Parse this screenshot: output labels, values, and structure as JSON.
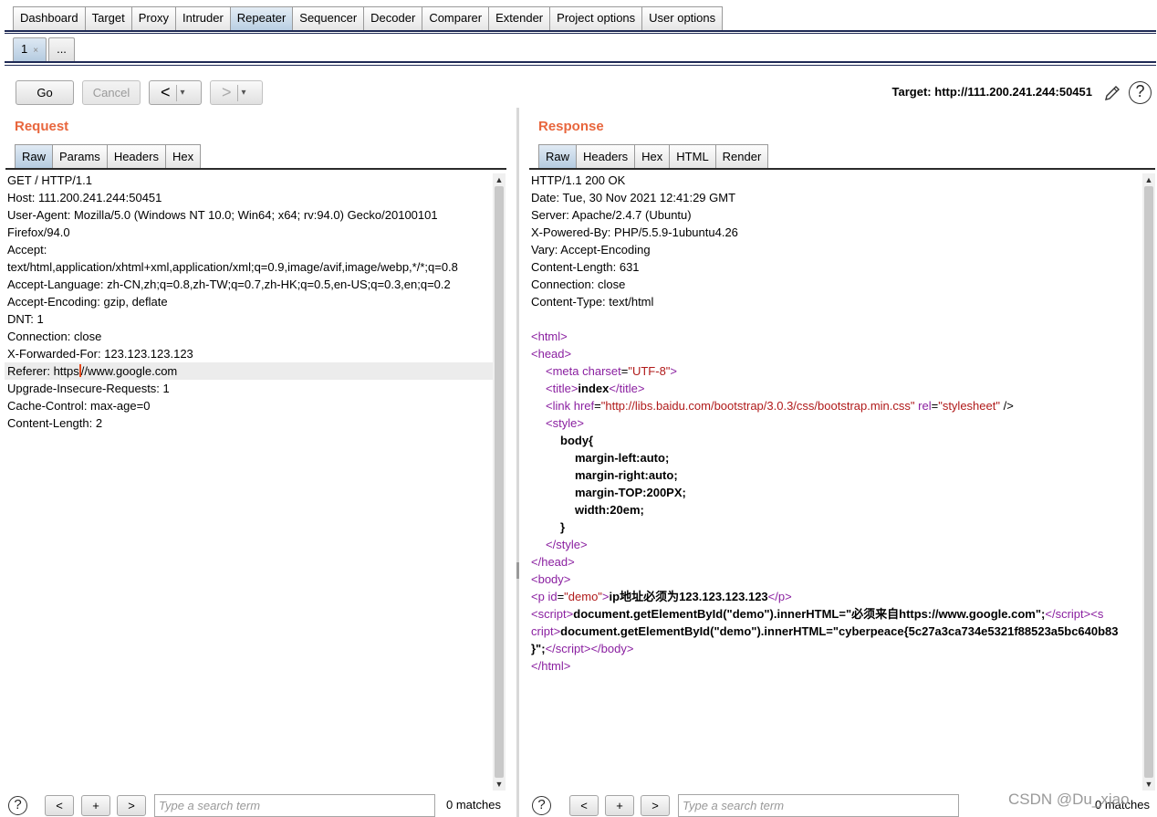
{
  "top_tabs": [
    "Dashboard",
    "Target",
    "Proxy",
    "Intruder",
    "Repeater",
    "Sequencer",
    "Decoder",
    "Comparer",
    "Extender",
    "Project options",
    "User options"
  ],
  "active_top_tab": "Repeater",
  "sub_tabs": {
    "first": "1",
    "more": "..."
  },
  "toolbar": {
    "go": "Go",
    "cancel": "Cancel",
    "back": "<",
    "forward": ">",
    "dropdown": "▾",
    "target": "Target: http://111.200.241.244:50451"
  },
  "request": {
    "title": "Request",
    "tabs": [
      "Raw",
      "Params",
      "Headers",
      "Hex"
    ],
    "lines": [
      "GET / HTTP/1.1",
      "Host: 111.200.241.244:50451",
      "User-Agent: Mozilla/5.0 (Windows NT 10.0; Win64; x64; rv:94.0) Gecko/20100101",
      "Firefox/94.0",
      "Accept:",
      "text/html,application/xhtml+xml,application/xml;q=0.9,image/avif,image/webp,*/*;q=0.8",
      "Accept-Language: zh-CN,zh;q=0.8,zh-TW;q=0.7,zh-HK;q=0.5,en-US;q=0.3,en;q=0.2",
      "Accept-Encoding: gzip, deflate",
      "DNT: 1",
      "Connection: close",
      "X-Forwarded-For: 123.123.123.123",
      "Referer: https",
      "Upgrade-Insecure-Requests: 1",
      "Cache-Control: max-age=0",
      "Content-Length: 2"
    ],
    "referer_rest": "//www.google.com"
  },
  "response": {
    "title": "Response",
    "tabs": [
      "Raw",
      "Headers",
      "Hex",
      "HTML",
      "Render"
    ],
    "headers": [
      "HTTP/1.1 200 OK",
      "Date: Tue, 30 Nov 2021 12:41:29 GMT",
      "Server: Apache/2.4.7 (Ubuntu)",
      "X-Powered-By: PHP/5.5.9-1ubuntu4.26",
      "Vary: Accept-Encoding",
      "Content-Length: 631",
      "Connection: close",
      "Content-Type: text/html"
    ],
    "body": {
      "lt": "<",
      "gt": ">",
      "slash": "/",
      "html": "html",
      "head": "head",
      "meta_tag": "meta",
      "charset_attr": "charset",
      "charset_val": "\"UTF-8\"",
      "title_tag": "title",
      "title_text": "index",
      "link_tag": "link",
      "href_attr": "href",
      "href_val": "\"http://libs.baidu.com/bootstrap/3.0.3/css/bootstrap.min.css\"",
      "rel_attr": "rel",
      "rel_val": "\"stylesheet\"",
      "self_close": " />",
      "style_tag": "style",
      "css_lines": [
        "body{",
        "margin-left:auto;",
        "margin-right:auto;",
        "margin-TOP:200PX;",
        "width:20em;",
        "}"
      ],
      "body_tag": "body",
      "p_tag": "p",
      "id_attr": "id",
      "id_val": "\"demo\"",
      "p_text": "ip地址必须为123.123.123.123",
      "script_tag": "script",
      "script1": "document.getElementById(\"demo\").innerHTML=\"必须来自https://www.google.com\";",
      "script_split_a": "s",
      "script_split_b": "cript",
      "script2": "document.getElementById(\"demo\").innerHTML=\"cyberpeace{5c27a3ca734e5321f88523a5bc640b83",
      "script2_end": "}\";"
    }
  },
  "search": {
    "help": "?",
    "prev": "<",
    "add": "+",
    "next": ">",
    "placeholder": "Type a search term",
    "matches": "0 matches"
  },
  "watermark": "CSDN @Du_xiao"
}
